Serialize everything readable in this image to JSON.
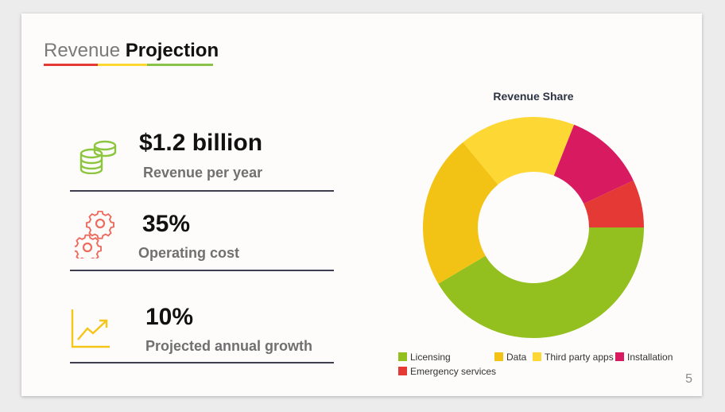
{
  "slide": {
    "title_light": "Revenue",
    "title_bold": "Projection",
    "title_bar_colors": [
      "#e53935",
      "#fdd835",
      "#8bc34a"
    ],
    "page_number": "5"
  },
  "kpis": [
    {
      "value": "$1.2 billion",
      "label": "Revenue per year",
      "icon": "coins-icon",
      "icon_color": "#8cc63f"
    },
    {
      "value": "35%",
      "label": "Operating cost",
      "icon": "gears-icon",
      "icon_color": "#ec6b5e"
    },
    {
      "value": "10%",
      "label": "Projected annual growth",
      "icon": "growth-chart-icon",
      "icon_color": "#f5c518"
    }
  ],
  "chart_data": {
    "type": "pie",
    "title": "Revenue Share",
    "donut": true,
    "series": [
      {
        "name": "Licensing",
        "value": 41.5,
        "color": "#93c01f"
      },
      {
        "name": "Data",
        "value": 22.5,
        "color": "#f2c314"
      },
      {
        "name": "Third party apps",
        "value": 17,
        "color": "#fdd835"
      },
      {
        "name": "Installation",
        "value": 12,
        "color": "#d81b60"
      },
      {
        "name": "Emergency services",
        "value": 7,
        "color": "#e53935"
      }
    ],
    "legend_position": "bottom"
  }
}
